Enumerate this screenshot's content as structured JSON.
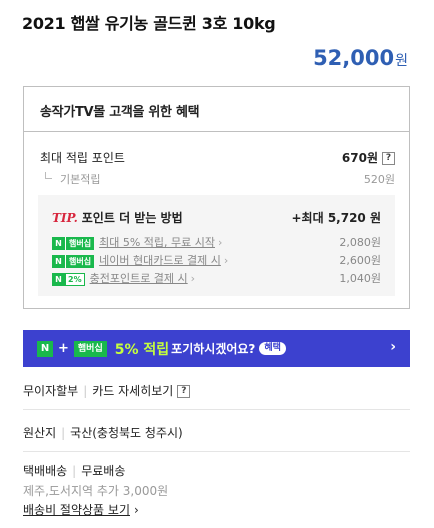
{
  "product": {
    "title": "2021 햅쌀 유기농 골드퀸 3호 10kg",
    "price": "52,000",
    "price_unit": "원"
  },
  "benefit": {
    "header": "송작가TV몰 고객을 위한 혜택",
    "max_label": "최대 적립 포인트",
    "max_value": "670원",
    "basic_label": "기본적립",
    "basic_value": "520원",
    "tip": {
      "tip_word": "TIP.",
      "title": "포인트 더 받는 방법",
      "max_label": "+최대 5,720 원",
      "rows": [
        {
          "badge_n": "N",
          "badge_plus": "+",
          "badge_text": "햄버십",
          "text": "최대 5% 적립, 무료 시작",
          "value": "2,080원"
        },
        {
          "badge_n": "N",
          "badge_plus": "+",
          "badge_text": "햄버십",
          "text": "네이버 현대카드로 결제 시",
          "value": "2,600원"
        },
        {
          "badge_n": "N",
          "badge_text": "2%",
          "text": "충전포인트로 결제 시",
          "value": "1,040원"
        }
      ]
    }
  },
  "banner": {
    "n": "N",
    "plus": "+",
    "membership": "햄버십",
    "highlight": "5% 적립",
    "question": "포기하시겠어요?",
    "button": "혜택",
    "arrow": "›"
  },
  "installment": {
    "label": "무이자할부",
    "link": "카드 자세히보기",
    "help": "?"
  },
  "origin": {
    "label": "원산지",
    "value": "국산(충청북도 청주시)"
  },
  "delivery": {
    "label": "택배배송",
    "value": "무료배송",
    "extra": "제주,도서지역 추가 3,000원",
    "link": "배송비 절약상품 보기",
    "link_arrow": "›"
  },
  "colors": {
    "price": "#2f5fb3",
    "banner_bg": "#3c41cf",
    "naver_green": "#19b84c",
    "tip_red": "#d7263d"
  },
  "icons": [
    "help-icon",
    "chevron-right-icon",
    "naver-plus-badge-icon"
  ]
}
